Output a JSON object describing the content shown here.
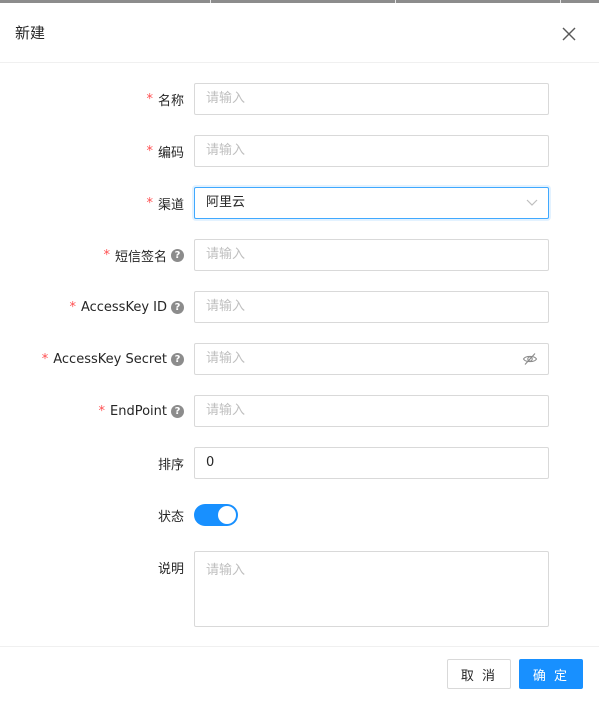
{
  "dialog": {
    "title": "新建",
    "close_icon": "close-icon"
  },
  "form": {
    "name": {
      "label": "名称",
      "required": true,
      "placeholder": "请输入"
    },
    "code": {
      "label": "编码",
      "required": true,
      "placeholder": "请输入"
    },
    "channel": {
      "label": "渠道",
      "required": true,
      "value": "阿里云",
      "icon": "chevron-down-icon"
    },
    "sms_signature": {
      "label": "短信签名",
      "required": true,
      "help": true,
      "placeholder": "请输入"
    },
    "access_key_id": {
      "label": "AccessKey ID",
      "required": true,
      "help": true,
      "placeholder": "请输入"
    },
    "access_key_secret": {
      "label": "AccessKey Secret",
      "required": true,
      "help": true,
      "placeholder": "请输入",
      "icon": "eye-invisible-icon"
    },
    "endpoint": {
      "label": "EndPoint",
      "required": true,
      "help": true,
      "placeholder": "请输入"
    },
    "sort": {
      "label": "排序",
      "value": "0"
    },
    "status": {
      "label": "状态",
      "enabled": true
    },
    "description": {
      "label": "说明",
      "placeholder": "请输入"
    }
  },
  "footer": {
    "cancel_label": "取 消",
    "ok_label": "确 定"
  },
  "colors": {
    "primary": "#1890ff",
    "required": "#ff4d4f",
    "placeholder": "#bfbfbf",
    "border": "#d9d9d9"
  },
  "required_mark": "*",
  "help_mark": "?"
}
